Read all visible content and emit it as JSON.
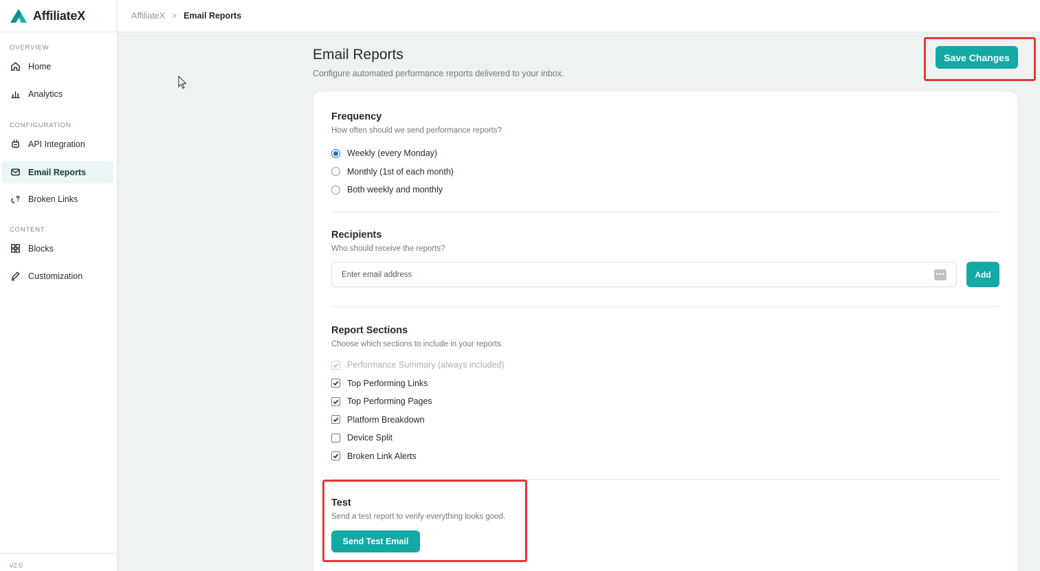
{
  "app": {
    "name": "AffiliateX",
    "version": "v2.0"
  },
  "colors": {
    "accent": "#12a9a6",
    "highlight_outline": "#e53935",
    "radio_selected": "#1a73c9"
  },
  "sidebar": {
    "sections": [
      {
        "label": "OVERVIEW",
        "items": [
          {
            "label": "Home",
            "icon": "home-icon"
          },
          {
            "label": "Analytics",
            "icon": "bar-chart-icon"
          }
        ]
      },
      {
        "label": "CONFIGURATION",
        "items": [
          {
            "label": "API Integration",
            "icon": "plug-icon"
          },
          {
            "label": "Email Reports",
            "icon": "mail-icon",
            "active": true
          },
          {
            "label": "Broken Links",
            "icon": "broken-link-icon"
          }
        ]
      },
      {
        "label": "CONTENT",
        "items": [
          {
            "label": "Blocks",
            "icon": "grid-icon"
          },
          {
            "label": "Customization",
            "icon": "pencil-icon"
          }
        ]
      }
    ]
  },
  "breadcrumb": {
    "root": "AffiliateX",
    "separator": ">",
    "current": "Email Reports"
  },
  "page": {
    "title": "Email Reports",
    "subtitle": "Configure automated performance reports delivered to your inbox.",
    "save_label": "Save Changes"
  },
  "frequency": {
    "title": "Frequency",
    "subtitle": "How often should we send performance reports?",
    "options": [
      {
        "label": "Weekly (every Monday)",
        "selected": true
      },
      {
        "label": "Monthly (1st of each month)",
        "selected": false
      },
      {
        "label": "Both weekly and monthly",
        "selected": false
      }
    ]
  },
  "recipients": {
    "title": "Recipients",
    "subtitle": "Who should receive the reports?",
    "input_placeholder": "Enter email address",
    "input_value": "",
    "add_label": "Add"
  },
  "report_sections": {
    "title": "Report Sections",
    "subtitle": "Choose which sections to include in your reports.",
    "items": [
      {
        "label": "Performance Summary (always included)",
        "checked": true,
        "disabled": true
      },
      {
        "label": "Top Performing Links",
        "checked": true,
        "disabled": false
      },
      {
        "label": "Top Performing Pages",
        "checked": true,
        "disabled": false
      },
      {
        "label": "Platform Breakdown",
        "checked": true,
        "disabled": false
      },
      {
        "label": "Device Split",
        "checked": false,
        "disabled": false
      },
      {
        "label": "Broken Link Alerts",
        "checked": true,
        "disabled": false
      }
    ]
  },
  "test": {
    "title": "Test",
    "subtitle": "Send a test report to verify everything looks good.",
    "button_label": "Send Test Email"
  }
}
